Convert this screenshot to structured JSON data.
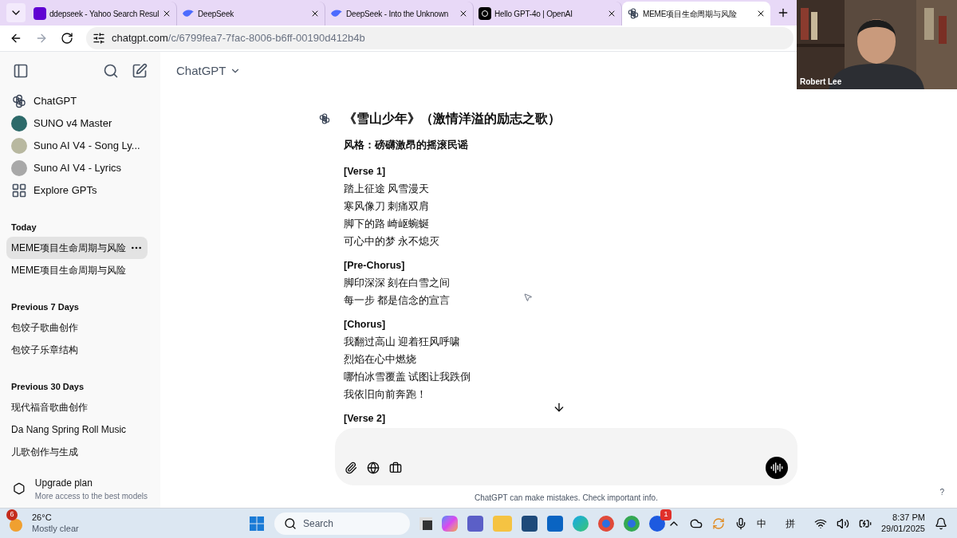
{
  "browser": {
    "tabs": [
      {
        "title": "ddepseek - Yahoo Search Resul",
        "selected": false
      },
      {
        "title": "DeepSeek",
        "selected": false
      },
      {
        "title": "DeepSeek - Into the Unknown",
        "selected": false
      },
      {
        "title": "Hello GPT-4o | OpenAI",
        "selected": false
      },
      {
        "title": "MEME项目生命周期与风险",
        "selected": true
      }
    ],
    "url_host": "chatgpt.com",
    "url_path": "/c/6799fea7-7fac-8006-b6ff-00190d412b4b"
  },
  "sidebar": {
    "gpts": [
      "ChatGPT",
      "SUNO v4 Master",
      "Suno AI V4 - Song Ly...",
      "Suno AI V4 - Lyrics",
      "Explore GPTs"
    ],
    "groups": [
      {
        "label": "Today",
        "chats": [
          {
            "title": "MEME项目生命周期与风险",
            "selected": true
          },
          {
            "title": "MEME项目生命周期与风险",
            "selected": false
          }
        ]
      },
      {
        "label": "Previous 7 Days",
        "chats": [
          {
            "title": "包饺子歌曲创作",
            "selected": false
          },
          {
            "title": "包饺子乐章结构",
            "selected": false
          }
        ]
      },
      {
        "label": "Previous 30 Days",
        "chats": [
          {
            "title": "现代福音歌曲创作",
            "selected": false
          },
          {
            "title": "Da Nang Spring Roll Music",
            "selected": false
          },
          {
            "title": "儿歌创作与生成",
            "selected": false
          }
        ]
      }
    ],
    "upgrade": {
      "title": "Upgrade plan",
      "subtitle": "More access to the best models"
    }
  },
  "header": {
    "model": "ChatGPT"
  },
  "message": {
    "title": "《雪山少年》（激情洋溢的励志之歌）",
    "style": "风格：磅礴激昂的摇滚民谣",
    "sections": [
      {
        "heading": "[Verse 1]",
        "lines": [
          "踏上征途 风雪漫天",
          "寒风像刀 刺痛双肩",
          "脚下的路 崎岖蜿蜒",
          "可心中的梦 永不熄灭"
        ]
      },
      {
        "heading": "[Pre-Chorus]",
        "lines": [
          "脚印深深 刻在白雪之间",
          "每一步 都是信念的宣言"
        ]
      },
      {
        "heading": "[Chorus]",
        "lines": [
          "我翻过高山 迎着狂风呼啸",
          "烈焰在心中燃烧",
          "哪怕冰雪覆盖 试图让我跌倒",
          "我依旧向前奔跑！"
        ]
      },
      {
        "heading": "[Verse 2]"
      }
    ]
  },
  "disclaimer": "ChatGPT can make mistakes. Check important info.",
  "help": "?",
  "webcam": {
    "name": "Robert Lee"
  },
  "taskbar": {
    "weather_badge": "6",
    "temperature": "26°C",
    "condition": "Mostly clear",
    "search_placeholder": "Search",
    "app_badge": "1",
    "ime_mode": "中",
    "ime_method": "拼",
    "time": "8:37 PM",
    "date": "29/01/2025"
  }
}
